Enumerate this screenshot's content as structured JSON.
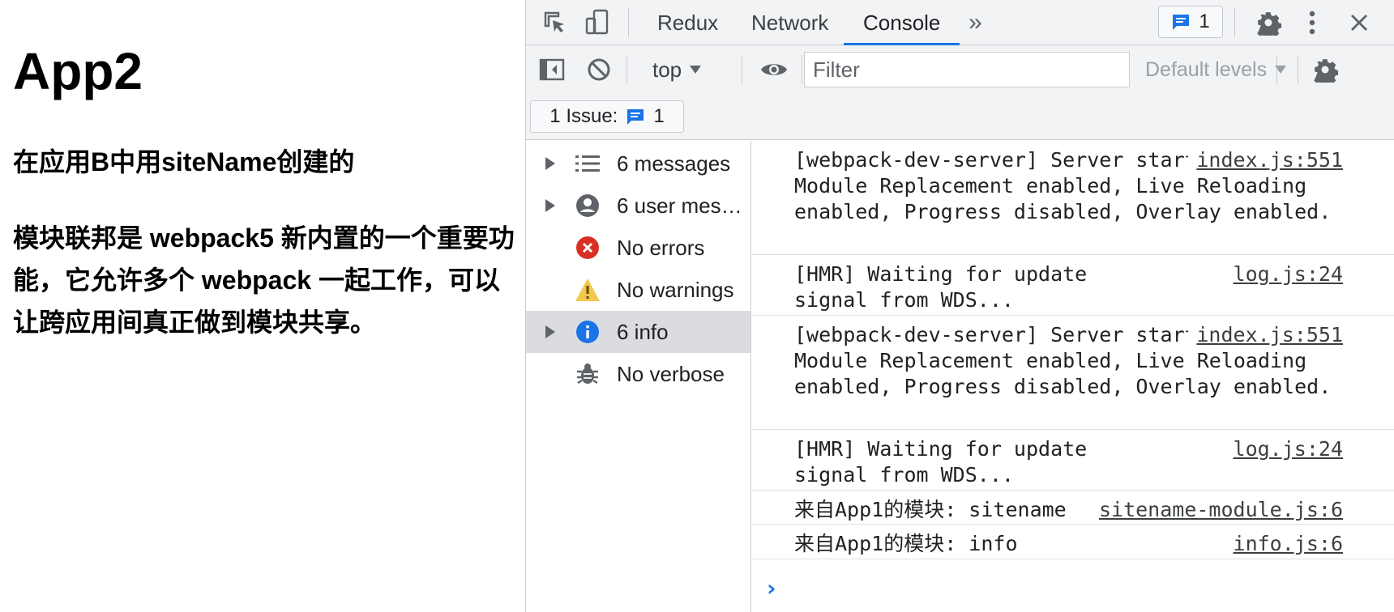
{
  "page": {
    "title": "App2",
    "subtitle": "在应用B中用siteName创建的",
    "description": "模块联邦是 webpack5 新内置的一个重要功能，它允许多个 webpack 一起工作，可以让跨应用间真正做到模块共享。"
  },
  "devtools": {
    "tabs": [
      {
        "label": "Redux"
      },
      {
        "label": "Network"
      },
      {
        "label": "Console",
        "active": true
      }
    ],
    "more_tabs_glyph": "»",
    "messages_badge": "1",
    "toolbar": {
      "context": "top",
      "filter_placeholder": "Filter",
      "levels": "Default levels"
    },
    "issues": {
      "label": "1 Issue:",
      "count": "1"
    },
    "sidebar": [
      {
        "label": "6 messages",
        "icon": "list-icon",
        "expandable": true
      },
      {
        "label": "6 user mes…",
        "icon": "user-icon",
        "expandable": true
      },
      {
        "label": "No errors",
        "icon": "error-icon",
        "expandable": false
      },
      {
        "label": "No warnings",
        "icon": "warning-icon",
        "expandable": false
      },
      {
        "label": "6 info",
        "icon": "info-icon",
        "expandable": true,
        "selected": true
      },
      {
        "label": "No verbose",
        "icon": "bug-icon",
        "expandable": false
      }
    ],
    "messages": [
      {
        "text": "[webpack-dev-server] Server started: Hot Module Replacement enabled, Live Reloading enabled, Progress disabled, Overlay enabled.",
        "source": "index.js:551"
      },
      {
        "text": "[HMR] Waiting for update signal from WDS...",
        "source": "log.js:24"
      },
      {
        "text": "[webpack-dev-server] Server started: Hot Module Replacement enabled, Live Reloading enabled, Progress disabled, Overlay enabled.",
        "source": "index.js:551"
      },
      {
        "text": "[HMR] Waiting for update signal from WDS...",
        "source": "log.js:24"
      },
      {
        "text": "来自App1的模块: sitename",
        "source": "sitename-module.js:6"
      },
      {
        "text": "来自App1的模块: info",
        "source": "info.js:6"
      }
    ],
    "prompt_glyph": "›",
    "colors": {
      "accent": "#1a73e8",
      "error": "#d93025",
      "warning": "#f2c94c",
      "info": "#1a73e8"
    }
  }
}
